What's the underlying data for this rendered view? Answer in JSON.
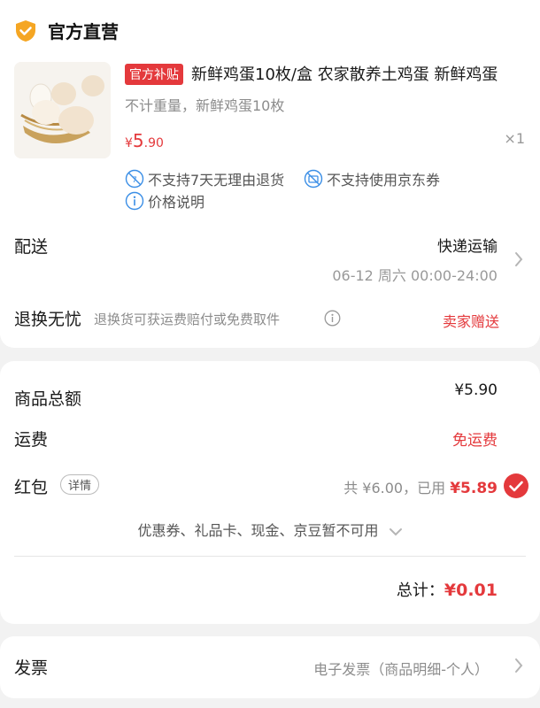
{
  "store": {
    "title": "官方直营"
  },
  "product": {
    "tag": "官方补贴",
    "title": "新鲜鸡蛋10枚/盒 农家散养土鸡蛋 新鲜鸡蛋",
    "spec": "不计重量，新鲜鸡蛋10枚",
    "price_currency": "¥",
    "price_int": "5",
    "price_dec": ".90",
    "qty": "×1"
  },
  "services": [
    {
      "label": "不支持7天无理由退货",
      "icon": "no-return-icon"
    },
    {
      "label": "不支持使用京东券",
      "icon": "no-coupon-icon"
    },
    {
      "label": "价格说明",
      "icon": "info-icon"
    }
  ],
  "delivery": {
    "label": "配送",
    "method": "快递运输",
    "time": "06-12 周六 00:00-24:00"
  },
  "return_service": {
    "label": "退换无忧",
    "desc": "退换货可获运费赔付或免费取件",
    "status": "卖家赠送"
  },
  "summary": {
    "goods_total_label": "商品总额",
    "goods_total_value": "¥5.90",
    "shipping_label": "运费",
    "shipping_value": "免运费",
    "redpacket_label": "红包",
    "redpacket_detail": "详情",
    "redpacket_total": "共 ¥6.00，已用",
    "redpacket_used": "¥5.89",
    "coupon_note": "优惠券、礼品卡、现金、京豆暂不可用",
    "grand_label": "总计：",
    "grand_value": "¥0.01"
  },
  "invoice": {
    "label": "发票",
    "value": "电子发票（商品明细-个人）"
  },
  "colors": {
    "accent": "#e4393c",
    "shield": "#f5a623"
  }
}
